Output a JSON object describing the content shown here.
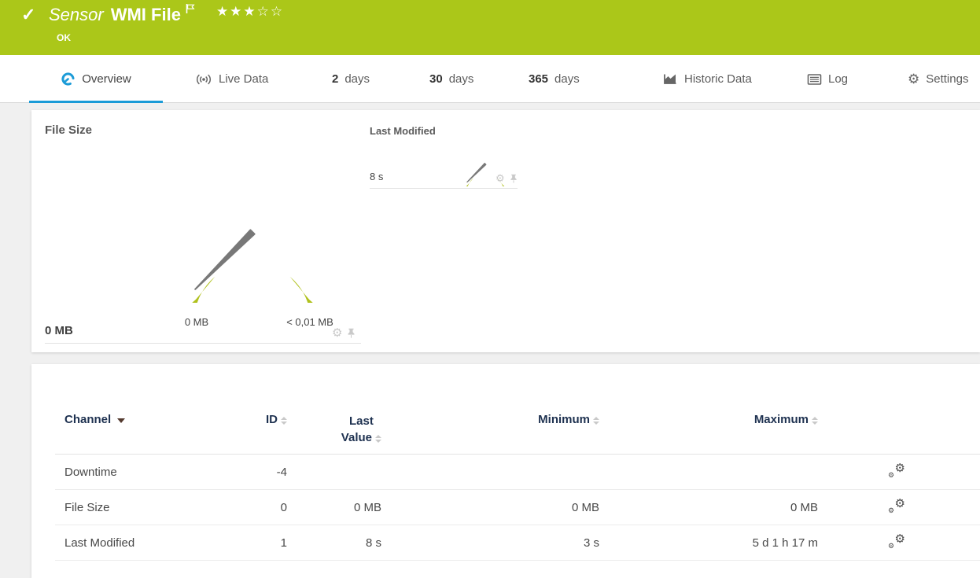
{
  "header": {
    "kind": "Sensor",
    "title": "WMI File",
    "status": "OK",
    "stars_filled": "★★★",
    "stars_empty": "☆☆"
  },
  "tabs": {
    "overview": "Overview",
    "live_data": "Live Data",
    "d2_num": "2",
    "d2_unit": "days",
    "d30_num": "30",
    "d30_unit": "days",
    "d365_num": "365",
    "d365_unit": "days",
    "historic": "Historic Data",
    "log": "Log",
    "settings": "Settings"
  },
  "panels": {
    "file_size": {
      "title": "File Size",
      "current": "0 MB",
      "gauge_min": "0 MB",
      "gauge_max": "< 0,01 MB"
    },
    "last_modified": {
      "title": "Last Modified",
      "current": "8 s"
    }
  },
  "table": {
    "headers": {
      "channel": "Channel",
      "id": "ID",
      "last_line1": "Last",
      "last_line2": "Value",
      "min": "Minimum",
      "max": "Maximum"
    },
    "rows": [
      {
        "channel": "Downtime",
        "id": "-4",
        "last": "",
        "min": "",
        "max": ""
      },
      {
        "channel": "File Size",
        "id": "0",
        "last": "0 MB",
        "min": "0 MB",
        "max": "0 MB"
      },
      {
        "channel": "Last Modified",
        "id": "1",
        "last": "8 s",
        "min": "3 s",
        "max": "5 d 1 h 17 m"
      }
    ]
  },
  "colors": {
    "status_green": "#abc719",
    "gauge_green": "#b0c11d",
    "accent_blue": "#1b9bd7"
  }
}
